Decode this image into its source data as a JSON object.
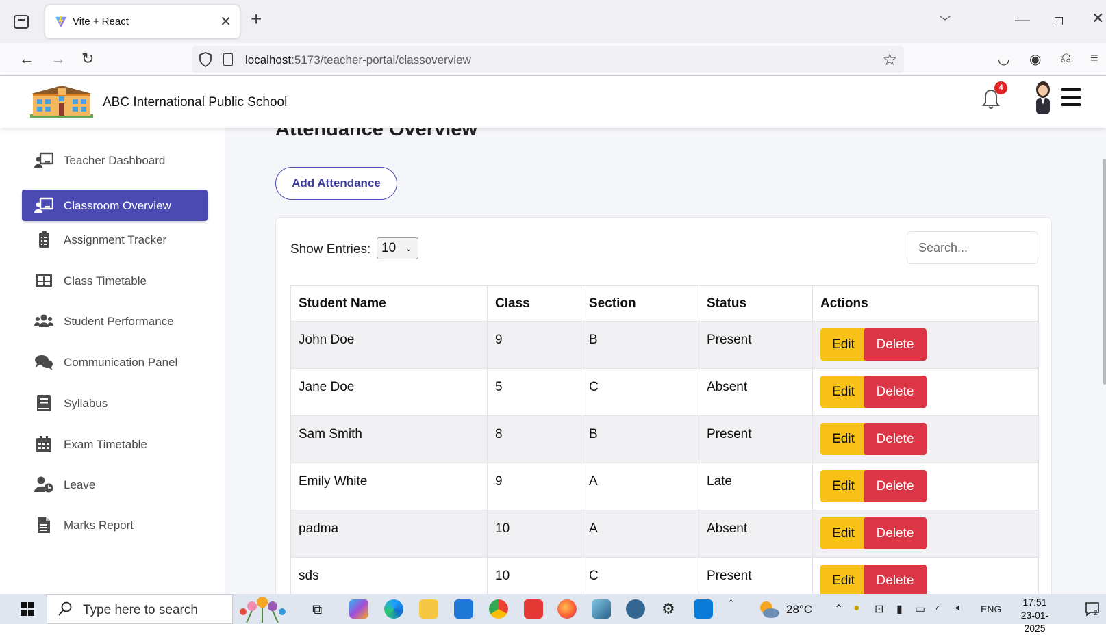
{
  "browser": {
    "tab_title": "Vite + React",
    "url_host": "localhost",
    "url_path": ":5173/teacher-portal/classoverview"
  },
  "header": {
    "school_name": "ABC International Public School",
    "notification_count": "4"
  },
  "sidebar": {
    "items": [
      {
        "label": "Teacher Dashboard",
        "icon": "chalkboard-teacher-icon"
      },
      {
        "label": "Classroom Overview",
        "icon": "chalkboard-teacher-icon",
        "active": true
      },
      {
        "label": "Assignment Tracker",
        "icon": "clipboard-list-icon"
      },
      {
        "label": "Class Timetable",
        "icon": "table-grid-icon"
      },
      {
        "label": "Student Performance",
        "icon": "users-icon"
      },
      {
        "label": "Communication Panel",
        "icon": "comments-icon"
      },
      {
        "label": "Syllabus",
        "icon": "book-icon"
      },
      {
        "label": "Exam Timetable",
        "icon": "calendar-icon"
      },
      {
        "label": "Leave",
        "icon": "user-clock-icon"
      },
      {
        "label": "Marks Report",
        "icon": "file-lines-icon"
      }
    ]
  },
  "main": {
    "title": "Attendance Overview",
    "add_button": "Add Attendance",
    "show_entries_label": "Show Entries:",
    "entries_value": "10",
    "search_placeholder": "Search...",
    "table": {
      "headers": [
        "Student Name",
        "Class",
        "Section",
        "Status",
        "Actions"
      ],
      "rows": [
        {
          "name": "John Doe",
          "class": "9",
          "section": "B",
          "status": "Present"
        },
        {
          "name": "Jane Doe",
          "class": "5",
          "section": "C",
          "status": "Absent"
        },
        {
          "name": "Sam Smith",
          "class": "8",
          "section": "B",
          "status": "Present"
        },
        {
          "name": "Emily White",
          "class": "9",
          "section": "A",
          "status": "Late"
        },
        {
          "name": "padma",
          "class": "10",
          "section": "A",
          "status": "Absent"
        },
        {
          "name": "sds",
          "class": "10",
          "section": "C",
          "status": "Present"
        }
      ],
      "edit_label": "Edit",
      "delete_label": "Delete"
    }
  },
  "taskbar": {
    "search_text": "Type here to search",
    "temperature": "28°C",
    "language": "ENG",
    "time": "17:51",
    "date": "23-01-2025",
    "notification_count": "2"
  },
  "colors": {
    "accent": "#4a4ab2",
    "edit": "#f7c117",
    "delete": "#dc3545",
    "badge": "#e02424"
  }
}
